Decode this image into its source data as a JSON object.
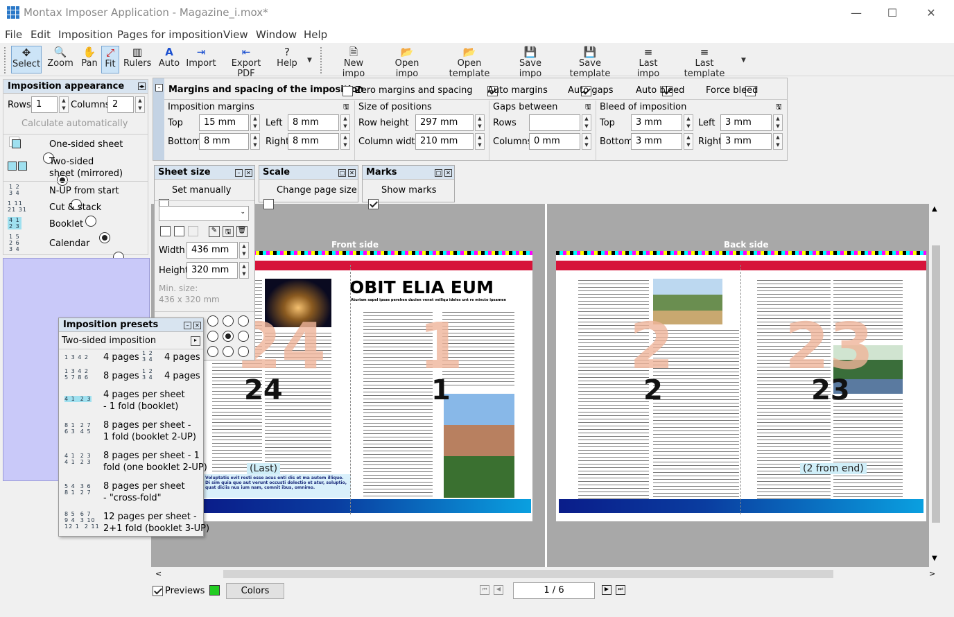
{
  "window": {
    "title": "Montax Imposer Application - Magazine_i.mox*",
    "minimize": "—",
    "maximize": "☐",
    "close": "✕"
  },
  "menu": [
    "File",
    "Edit",
    "Imposition",
    "Pages for imposition",
    "View",
    "Window",
    "Help"
  ],
  "toolbar_left": [
    {
      "label": "Select",
      "icon": "✥"
    },
    {
      "label": "Zoom",
      "icon": "🔍"
    },
    {
      "label": "Pan",
      "icon": "✋"
    },
    {
      "label": "Fit",
      "icon": "⤢"
    },
    {
      "label": "Rulers",
      "icon": "▥"
    },
    {
      "label": "Auto",
      "icon": "A"
    },
    {
      "label": "Import",
      "icon": "⇥"
    },
    {
      "label": "Export PDF",
      "icon": "⇤"
    },
    {
      "label": "Help",
      "icon": "?"
    }
  ],
  "toolbar_right": [
    {
      "label": "New impo",
      "icon": "🗎"
    },
    {
      "label": "Open impo",
      "icon": "📂"
    },
    {
      "label": "Open template",
      "icon": "📂"
    },
    {
      "label": "Save impo",
      "icon": "💾"
    },
    {
      "label": "Save template",
      "icon": "💾"
    },
    {
      "label": "Last impo",
      "icon": "≡"
    },
    {
      "label": "Last template",
      "icon": "≡"
    }
  ],
  "appearance": {
    "title": "Imposition appearance",
    "rows_label": "Rows",
    "rows": "1",
    "columns_label": "Columns",
    "columns": "2",
    "calc_auto": "Calculate automatically",
    "options": [
      {
        "label": "One-sided sheet",
        "icon_nums": "",
        "selected": false
      },
      {
        "label": "Two-sided\nsheet (mirrored)",
        "icon_nums": "",
        "selected": true
      },
      {
        "label": "N-UP from start",
        "icon_nums": "1 2\n3 4",
        "selected": false
      },
      {
        "label": "Cut & stack",
        "icon_nums": "1 11\n21 31",
        "selected": false
      },
      {
        "label": "Booklet",
        "icon_nums": "4 1\n2 3",
        "selected": true
      },
      {
        "label": "Calendar",
        "icon_nums": "1 5\n2 6\n3 4",
        "selected": false
      }
    ]
  },
  "margins": {
    "title": "Margins and spacing of the imposition",
    "zero": "Zero margins and spacing",
    "auto_margins": "Auto margins",
    "auto_gaps": "Auto gaps",
    "auto_bleed": "Auto bleed",
    "force_bleed": "Force bleed",
    "imposition_margins": {
      "title": "Imposition margins",
      "top_label": "Top",
      "top": "15 mm",
      "left_label": "Left",
      "left": "8 mm",
      "bottom_label": "Bottom",
      "bottom": "8 mm",
      "right_label": "Right",
      "right": "8 mm"
    },
    "size_positions": {
      "title": "Size of positions",
      "row_height_label": "Row height",
      "row_height": "297 mm",
      "col_width_label": "Column width",
      "col_width": "210 mm"
    },
    "gaps": {
      "title": "Gaps between",
      "rows_label": "Rows",
      "rows": "",
      "columns_label": "Columns",
      "columns": "0 mm"
    },
    "bleed": {
      "title": "Bleed of imposition",
      "top_label": "Top",
      "top": "3 mm",
      "left_label": "Left",
      "left": "3 mm",
      "bottom_label": "Bottom",
      "bottom": "3 mm",
      "right_label": "Right",
      "right": "3 mm"
    }
  },
  "sheet_size": {
    "title": "Sheet size",
    "set_manually": "Set manually",
    "width_label": "Width",
    "width": "436 mm",
    "height_label": "Height",
    "height": "320 mm",
    "min_size": "Min. size:\n436 x 320 mm"
  },
  "scale": {
    "title": "Scale",
    "change_page_size": "Change page size"
  },
  "marks": {
    "title": "Marks",
    "show_marks": "Show marks"
  },
  "presets": {
    "title": "Imposition presets",
    "dropdown": "Two-sided imposition",
    "items": [
      {
        "nums": "1 3 4 2",
        "label": "4 pages"
      },
      {
        "nums": "1 2\n3 4",
        "label": "4 pages"
      },
      {
        "nums": "1 3 4 2\n5 7 8 6",
        "label": "8 pages"
      },
      {
        "nums": "1 2\n3 4",
        "label": "4 pages"
      },
      {
        "nums": "4 1  2 3",
        "label": "4 pages per sheet\n- 1 fold (booklet)"
      },
      {
        "nums": "8 1  2 7\n6 3  4 5",
        "label": "8 pages per sheet -\n1 fold (booklet 2-UP)"
      },
      {
        "nums": "4 1  2 3\n4 1  2 3",
        "label": "8 pages per sheet - 1\nfold (one booklet 2-UP)"
      },
      {
        "nums": "5 4  3 6\n8 1  2 7",
        "label": "8 pages per sheet\n- \"cross-fold\""
      },
      {
        "nums": "8 5  6 7\n9 4  3 10\n12 1  2 11",
        "label": "12 pages per sheet -\n2+1 fold (booklet 3-UP)"
      }
    ]
  },
  "canvas": {
    "front_label": "Front side",
    "back_label": "Back side",
    "front_left_num": "24",
    "front_left_faint": "24",
    "front_right_num": "1",
    "front_right_faint": "1",
    "front_left_tag": "(Last)",
    "back_left_num": "2",
    "back_left_faint": "2",
    "back_right_num": "23",
    "back_right_faint": "23",
    "back_right_tag": "(2 from end)",
    "headline": "OBIT ELIA EUM",
    "subhead": "Aturiam sapel ipsae perehen ducien venet velliqu ideles unt re mincto ipsamen",
    "front_blurb": "Voluptatis evit resti esse acus enti dis et ma autem illique. Di sim quia quo aut verunt occusti dolectio et atur, soluptio, quat diciis nus ium nam, comnit ibus, omnimo."
  },
  "statusbar": {
    "previews": "Previews",
    "colors": "Colors",
    "page_indicator": "1 / 6"
  },
  "colors": {
    "accent_selected": "#cce4f7",
    "panel_lavender": "#c9c9f9",
    "preview_green": "#22cc22",
    "red_band": "#d6143a"
  }
}
